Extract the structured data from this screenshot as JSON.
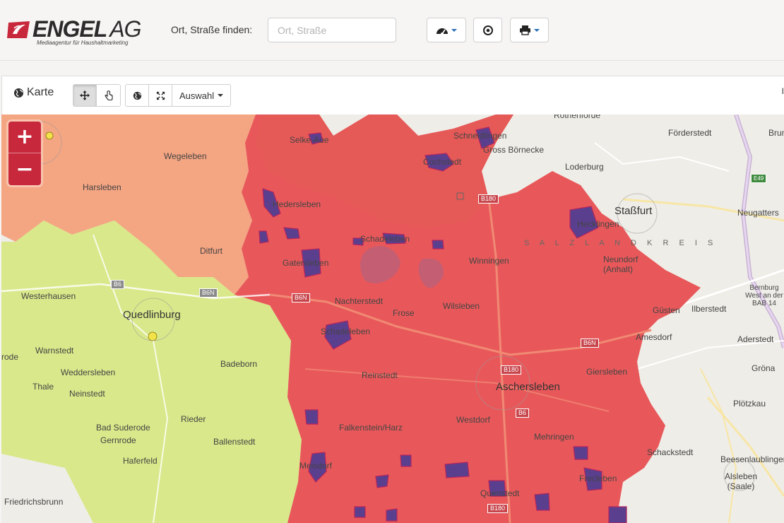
{
  "header": {
    "logo": {
      "name": "ENGEL",
      "suffix": "AG",
      "tagline": "Mediaagentur für Haushaltmarketing"
    },
    "search": {
      "label": "Ort, Straße finden:",
      "placeholder": "Ort, Straße",
      "value": ""
    },
    "buttons": [
      {
        "name": "dashboard-dropdown-button",
        "icon": "dashboard-icon",
        "has_caret": true
      },
      {
        "name": "locate-button",
        "icon": "target-icon",
        "has_caret": false
      },
      {
        "name": "print-dropdown-button",
        "icon": "print-icon",
        "has_caret": true
      }
    ]
  },
  "panel": {
    "title": "Karte",
    "title_icon": "globe-icon",
    "toolbar": {
      "pan_icon": "move-icon",
      "select_icon": "hand-pointer-icon",
      "globe_icon": "globe-icon",
      "fullscreen_icon": "expand-icon",
      "selection_label": "Auswahl"
    },
    "edge_text": "I"
  },
  "map": {
    "zoom_in": "+",
    "zoom_out": "−",
    "colors": {
      "selected_region": "#e8585a",
      "orange_region": "#f4a582",
      "green_region": "#d9e88a",
      "district": "#5b3f8f",
      "accent": "#c8283c"
    },
    "labels": [
      "Rothenförde",
      "Förderstedt",
      "Brum",
      "Selke-Aue",
      "Schneidlingen",
      "Gross Börnecke",
      "Wegeleben",
      "Loderburg",
      "Cochstedt",
      "Harsleben",
      "Hedersleben",
      "Staßfurt",
      "Neugatters",
      "Hecklingen",
      "Schadeleben",
      "Ditfurt",
      "S A L Z L A N D K R E I S",
      "Gatersleben",
      "Winningen",
      "Neundorf (Anhalt)",
      "Westerhausen",
      "Nachterstedt",
      "Frose",
      "Wilsleben",
      "Güsten",
      "Ilberstedt",
      "Quedlinburg",
      "Bernburg West an der BAB 14",
      "Warnstedt",
      "Schadeleben",
      "Amesdorf",
      "Aderstedt",
      "rode",
      "Weddersleben",
      "Badeborn",
      "Reinstedt",
      "Giersleben",
      "Gröna",
      "Thale",
      "Neinstedt",
      "Aschersleben",
      "Plötzkau",
      "Rieder",
      "Bad Suderode",
      "Gernrode",
      "Falkenstein/Harz",
      "Westdorf",
      "Mehringen",
      "Ballenstedt",
      "Schackstedt",
      "Haferfeld",
      "Meisdorf",
      "Beesenlaublingen",
      "Frecleben",
      "Alsleben (Saale)",
      "Quenstedt",
      "Friedrichsbrunn"
    ],
    "road_labels": [
      "B180",
      "B6",
      "B6N",
      "B6N",
      "B6N",
      "B6",
      "B180",
      "B180",
      "B6",
      "E49"
    ]
  }
}
